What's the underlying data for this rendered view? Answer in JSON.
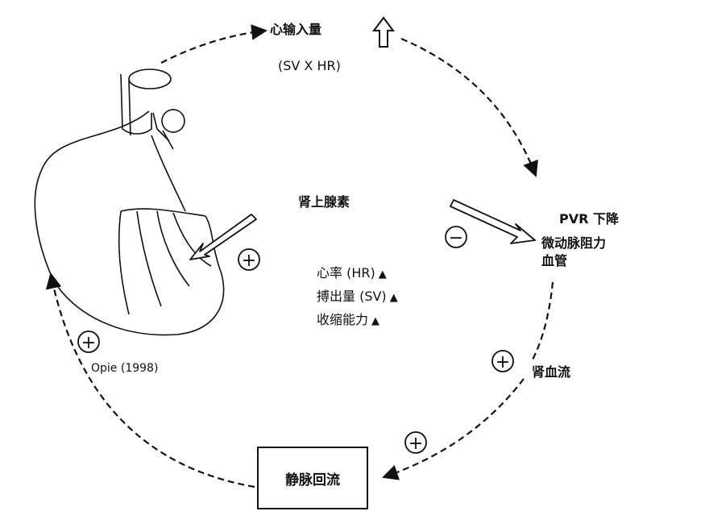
{
  "cardiac_output": {
    "label": "心输入量",
    "formula": "(SV X HR)"
  },
  "adrenaline": {
    "label": "肾上腺素"
  },
  "effects": [
    {
      "label": "心率 (HR)"
    },
    {
      "label": "搏出量 (SV)"
    },
    {
      "label": "收缩能力"
    }
  ],
  "pvr": {
    "line1": "PVR 下降",
    "line2": "微动脉阻力",
    "line3": "血管"
  },
  "renal_flow": {
    "label": "肾血流"
  },
  "venous_return": {
    "label": "静脉回流"
  },
  "citation": {
    "text": "Opie (1998)"
  },
  "signs": {
    "plus": "+",
    "minus": "−"
  }
}
